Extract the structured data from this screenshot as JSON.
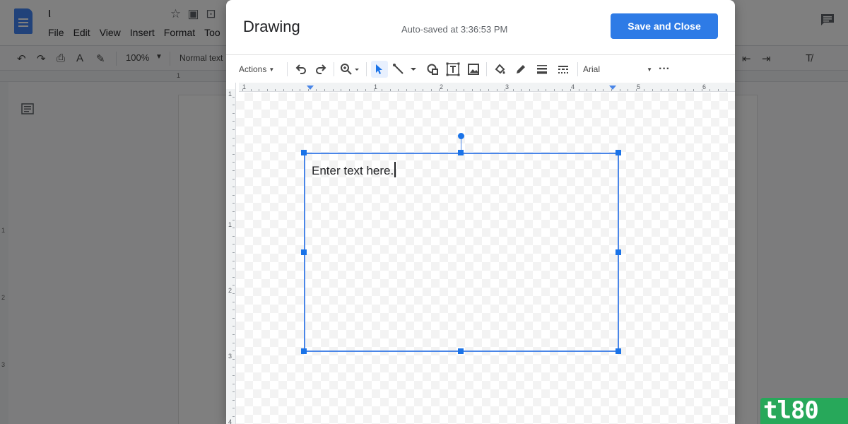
{
  "docs": {
    "title": "ι",
    "menu": [
      "File",
      "Edit",
      "View",
      "Insert",
      "Format",
      "Too"
    ],
    "zoom": "100%",
    "style": "Normal text",
    "ruler_mark": "1",
    "vruler_marks": [
      "1",
      "2",
      "3"
    ]
  },
  "dialog": {
    "title": "Drawing",
    "autosave": "Auto-saved at 3:36:53 PM",
    "save_close_label": "Save and Close",
    "toolbar": {
      "actions_label": "Actions",
      "font": "Arial",
      "icons": [
        "undo-icon",
        "redo-icon",
        "zoom-icon",
        "select-icon",
        "line-icon",
        "shape-icon",
        "textbox-icon",
        "image-icon",
        "fill-color-icon",
        "border-color-icon",
        "border-weight-icon",
        "border-dash-icon",
        "more-icon"
      ]
    },
    "h_ruler_labels": [
      "1",
      "1",
      "2",
      "3",
      "4",
      "5",
      "6"
    ],
    "v_ruler_labels": [
      "1",
      "1",
      "2",
      "3",
      "4"
    ],
    "textbox": {
      "text": "Enter text here."
    }
  },
  "colors": {
    "accent": "#1a73e8",
    "selection": "#4a86e8",
    "save_button": "#2e7be6",
    "watermark": "#27a85a"
  },
  "watermark": "tl80"
}
